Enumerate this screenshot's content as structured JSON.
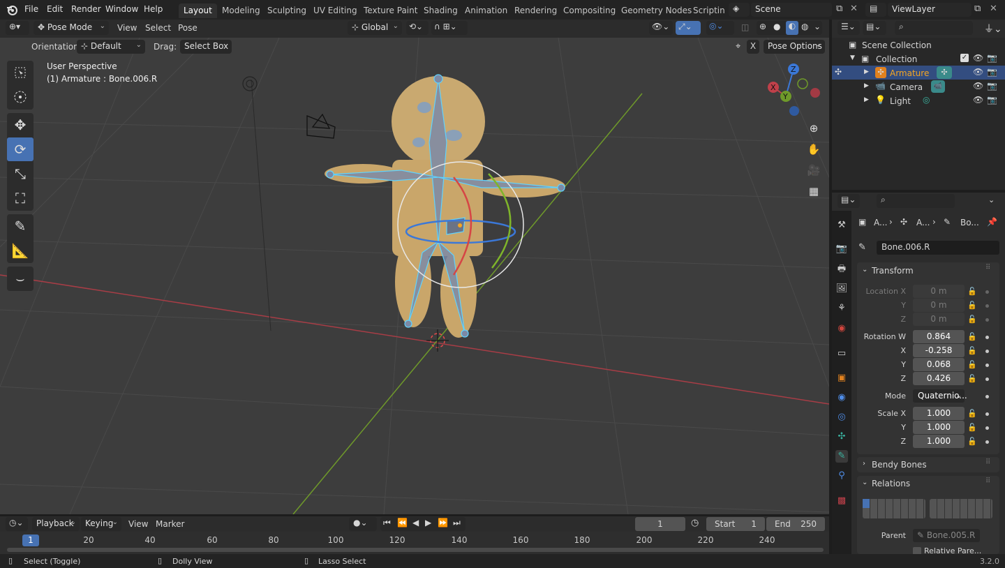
{
  "menu": {
    "file": "File",
    "edit": "Edit",
    "render": "Render",
    "window": "Window",
    "help": "Help"
  },
  "workspaces": [
    "Layout",
    "Modeling",
    "Sculpting",
    "UV Editing",
    "Texture Paint",
    "Shading",
    "Animation",
    "Rendering",
    "Compositing",
    "Geometry Nodes",
    "Scripting"
  ],
  "scene": {
    "name": "Scene",
    "view_layer": "ViewLayer"
  },
  "viewport_header": {
    "mode": "Pose Mode",
    "view": "View",
    "select": "Select",
    "pose": "Pose",
    "transform_orientation": "Global"
  },
  "tool_options": {
    "orientation_label": "Orientation:",
    "orientation_value": "Default",
    "drag_label": "Drag:",
    "drag_value": "Select Box",
    "x_mirror": "X",
    "pose_options": "Pose Options"
  },
  "viewport_info": {
    "perspective": "User Perspective",
    "active": "(1) Armature : Bone.006.R"
  },
  "gizmo": {
    "z": "Z",
    "y": "Y",
    "x": "X"
  },
  "outliner": {
    "scene_collection": "Scene Collection",
    "collection": "Collection",
    "items": [
      {
        "name": "Armature",
        "selected": true
      },
      {
        "name": "Camera",
        "selected": false
      },
      {
        "name": "Light",
        "selected": false
      }
    ]
  },
  "properties": {
    "breadcrumb": [
      "A...",
      "A...",
      "Bo..."
    ],
    "bone_name": "Bone.006.R",
    "transform_label": "Transform",
    "location": {
      "label_x": "Location X",
      "label_y": "Y",
      "label_z": "Z",
      "x": "0 m",
      "y": "0 m",
      "z": "0 m"
    },
    "rotation": {
      "label_w": "Rotation W",
      "label_x": "X",
      "label_y": "Y",
      "label_z": "Z",
      "w": "0.864",
      "x": "-0.258",
      "y": "0.068",
      "z": "0.426"
    },
    "mode_label": "Mode",
    "mode_value": "Quaternio...",
    "scale": {
      "label_x": "Scale X",
      "label_y": "Y",
      "label_z": "Z",
      "x": "1.000",
      "y": "1.000",
      "z": "1.000"
    },
    "bendy_bones": "Bendy Bones",
    "relations": "Relations",
    "parent_label": "Parent",
    "parent_value": "Bone.005.R",
    "relative_parent": "Relative Pare..."
  },
  "timeline": {
    "playback": "Playback",
    "keying": "Keying",
    "view": "View",
    "marker": "Marker",
    "current_frame": "1",
    "start_label": "Start",
    "start": "1",
    "end_label": "End",
    "end": "250",
    "ruler": [
      "1",
      "20",
      "40",
      "60",
      "80",
      "100",
      "120",
      "140",
      "160",
      "180",
      "200",
      "220",
      "240"
    ]
  },
  "status": {
    "select": "Select (Toggle)",
    "dolly": "Dolly View",
    "lasso": "Lasso Select",
    "version": "3.2.0"
  },
  "colors": {
    "accent": "#4772b3",
    "selection": "#334d80",
    "armature_text": "#f5a623",
    "bone_wire": "#5fd3ff",
    "x_axis": "#c0404a",
    "y_axis": "#6f9a2a",
    "z_axis": "#3b78d8"
  }
}
